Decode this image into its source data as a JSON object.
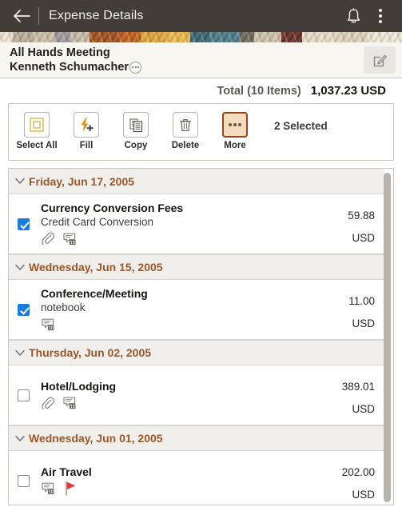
{
  "appbar": {
    "back_icon": "back-arrow-icon",
    "title": "Expense Details",
    "bell_icon": "notification-bell-icon",
    "menu_icon": "kebab-menu-icon"
  },
  "subheader": {
    "line1": "All Hands Meeting",
    "line2": "Kenneth Schumacher",
    "related_actions_icon": "related-actions-icon",
    "edit_icon": "edit-pencil-icon"
  },
  "total": {
    "label": "Total (10 Items)",
    "value": "1,037.23 USD"
  },
  "toolbar": {
    "buttons": [
      {
        "label": "Select All",
        "icon": "select-all-icon",
        "active": false
      },
      {
        "label": "Fill",
        "icon": "fill-lightning-plus-icon",
        "active": false
      },
      {
        "label": "Copy",
        "icon": "copy-documents-icon",
        "active": false
      },
      {
        "label": "Delete",
        "icon": "trash-icon",
        "active": false
      },
      {
        "label": "More",
        "icon": "more-dots-icon",
        "active": true
      }
    ],
    "selected_count": "2 Selected"
  },
  "groups": [
    {
      "date": "Friday, Jun 17, 2005",
      "collapse_icon": "chevron-down-icon",
      "rows": [
        {
          "checked": true,
          "type": "Currency Conversion Fees",
          "description": "Credit Card Conversion",
          "amount": "59.88",
          "currency": "USD",
          "icons": [
            "attachment-paperclip-icon",
            "comment-bubble-icon"
          ]
        }
      ]
    },
    {
      "date": "Wednesday, Jun 15, 2005",
      "collapse_icon": "chevron-down-icon",
      "rows": [
        {
          "checked": true,
          "type": "Conference/Meeting",
          "description": "notebook",
          "amount": "11.00",
          "currency": "USD",
          "icons": [
            "comment-bubble-icon"
          ]
        }
      ]
    },
    {
      "date": "Thursday, Jun 02, 2005",
      "collapse_icon": "chevron-down-icon",
      "rows": [
        {
          "checked": false,
          "type": "Hotel/Lodging",
          "description": "",
          "amount": "389.01",
          "currency": "USD",
          "icons": [
            "attachment-paperclip-icon",
            "comment-bubble-icon"
          ]
        }
      ]
    },
    {
      "date": "Wednesday, Jun 01, 2005",
      "collapse_icon": "chevron-down-icon",
      "rows": [
        {
          "checked": false,
          "type": "Air Travel",
          "description": "",
          "amount": "202.00",
          "currency": "USD",
          "icons": [
            "comment-bubble-icon",
            "red-flag-icon"
          ]
        }
      ]
    }
  ],
  "colors": {
    "appbar_bg": "#423d38",
    "date_header_text": "#9b572a",
    "checkbox_checked": "#1b7ae0",
    "accent_orange": "#e98a00",
    "flag_red": "#e33b3b",
    "more_active_bg": "#f3dcbe"
  }
}
